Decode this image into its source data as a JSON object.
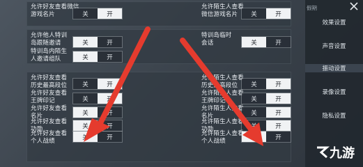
{
  "rows": [
    {
      "id": "r1",
      "label": "允许好友查看微信\n游戏名片",
      "off": "关",
      "on": "开",
      "selected": "on"
    },
    {
      "id": "r2",
      "label": "允许陌生人查看\n微信游戏名片",
      "off": "关",
      "on": "开",
      "selected": "on"
    },
    {
      "id": "r3",
      "label": "允许他人特训\n岛跟随邀请",
      "off": "关",
      "on": "开",
      "selected": "off"
    },
    {
      "id": "r4",
      "label": "特训岛临时\n会话",
      "off": "关",
      "on": "开",
      "selected": "off"
    },
    {
      "id": "r5",
      "label": "特训岛内陌生\n人邀请组队",
      "off": "关",
      "on": "开",
      "selected": "off"
    },
    {
      "id": "r6",
      "label": "允许好友查看\n历史最高段位",
      "off": "关",
      "on": "开",
      "selected": "on"
    },
    {
      "id": "r7",
      "label": "允许陌生人查看\n历史最高段位",
      "off": "关",
      "on": "开",
      "selected": "on"
    },
    {
      "id": "r8",
      "label": "允许好友查看\n王牌印记",
      "off": "关",
      "on": "开",
      "selected": "on"
    },
    {
      "id": "r9",
      "label": "允许陌生人查看\n王牌印记",
      "off": "关",
      "on": "开",
      "selected": "on"
    },
    {
      "id": "r10",
      "label": "允许好友查看\n名片",
      "off": "关",
      "on": "开",
      "selected": "off"
    },
    {
      "id": "r11",
      "label": "允许陌生人查看\n名片",
      "off": "关",
      "on": "开",
      "selected": "on"
    },
    {
      "id": "r12",
      "label": "允许好友查看\n功勋",
      "off": "关",
      "on": "开",
      "selected": "off"
    },
    {
      "id": "r13",
      "label": "允许陌生人查看\n功勋",
      "off": "关",
      "on": "开",
      "selected": "on"
    },
    {
      "id": "r14",
      "label": "允许好友查看\n个人战绩",
      "off": "关",
      "on": "开",
      "selected": "off"
    },
    {
      "id": "r15",
      "label": "允许陌生人查看\n个人战绩",
      "off": "关",
      "on": "开",
      "selected": "off"
    }
  ],
  "sidebar": {
    "top_text": "假期",
    "items": [
      {
        "label": "效果设置"
      },
      {
        "label": "声音设置"
      },
      {
        "label": "振动设置"
      },
      {
        "label": "录像设置"
      },
      {
        "label": "隐私设置"
      }
    ]
  },
  "watermark": {
    "text": "九游"
  },
  "colors": {
    "arrow": "#e53b2e",
    "toggle_on": "#f0f2f4"
  }
}
